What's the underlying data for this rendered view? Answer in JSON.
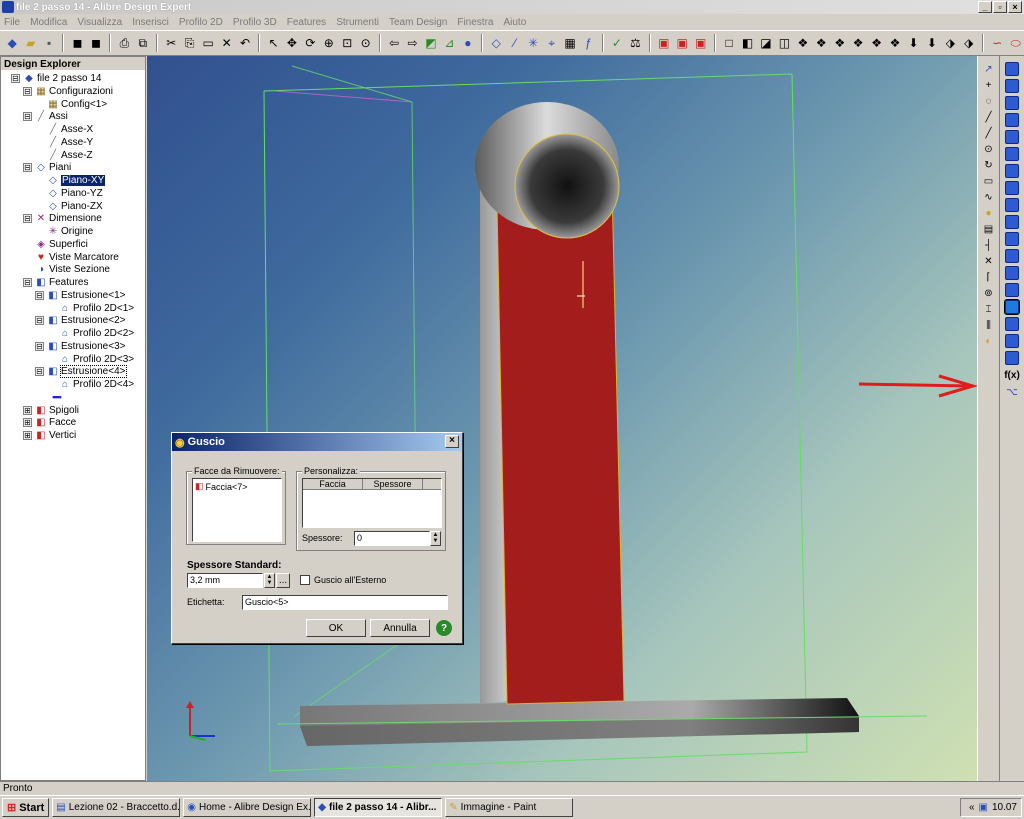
{
  "window": {
    "title": "file 2 passo 14 - Alibre Design Expert",
    "min": "_",
    "max": "▫",
    "close": "×"
  },
  "menu": [
    "File",
    "Modifica",
    "Visualizza",
    "Inserisci",
    "Profilo 2D",
    "Profilo 3D",
    "Features",
    "Strumenti",
    "Team Design",
    "Finestra",
    "Aiuto"
  ],
  "explorer": {
    "title": "Design Explorer",
    "nodes": [
      {
        "label": "file 2 passo 14",
        "level": 0,
        "exp": "⊟",
        "icon": "part-icon"
      },
      {
        "label": "Configurazioni",
        "level": 1,
        "exp": "⊟",
        "icon": "config-icon"
      },
      {
        "label": "Config<1>",
        "level": 2,
        "exp": "",
        "icon": "config-item-icon"
      },
      {
        "label": "Assi",
        "level": 1,
        "exp": "⊟",
        "icon": "axes-icon"
      },
      {
        "label": "Asse-X",
        "level": 2,
        "exp": "",
        "icon": "axis-icon"
      },
      {
        "label": "Asse-Y",
        "level": 2,
        "exp": "",
        "icon": "axis-icon"
      },
      {
        "label": "Asse-Z",
        "level": 2,
        "exp": "",
        "icon": "axis-icon"
      },
      {
        "label": "Piani",
        "level": 1,
        "exp": "⊟",
        "icon": "planes-icon"
      },
      {
        "label": "Piano-XY",
        "level": 2,
        "exp": "",
        "icon": "plane-icon",
        "selected": true
      },
      {
        "label": "Piano-YZ",
        "level": 2,
        "exp": "",
        "icon": "plane-icon"
      },
      {
        "label": "Piano-ZX",
        "level": 2,
        "exp": "",
        "icon": "plane-icon"
      },
      {
        "label": "Dimensione",
        "level": 1,
        "exp": "⊟",
        "icon": "dimension-icon"
      },
      {
        "label": "Origine",
        "level": 2,
        "exp": "",
        "icon": "origin-icon"
      },
      {
        "label": "Superfici",
        "level": 1,
        "exp": "",
        "icon": "surface-icon"
      },
      {
        "label": "Viste Marcatore",
        "level": 1,
        "exp": "",
        "icon": "marker-view-icon"
      },
      {
        "label": "Viste Sezione",
        "level": 1,
        "exp": "",
        "icon": "section-view-icon"
      },
      {
        "label": "Features",
        "level": 1,
        "exp": "⊟",
        "icon": "features-icon"
      },
      {
        "label": "Estrusione<1>",
        "level": 2,
        "exp": "⊟",
        "icon": "extrusion-icon"
      },
      {
        "label": "Profilo 2D<1>",
        "level": 3,
        "exp": "",
        "icon": "sketch-icon"
      },
      {
        "label": "Estrusione<2>",
        "level": 2,
        "exp": "⊟",
        "icon": "extrusion-icon"
      },
      {
        "label": "Profilo 2D<2>",
        "level": 3,
        "exp": "",
        "icon": "sketch-icon"
      },
      {
        "label": "Estrusione<3>",
        "level": 2,
        "exp": "⊟",
        "icon": "extrusion-icon"
      },
      {
        "label": "Profilo 2D<3>",
        "level": 3,
        "exp": "",
        "icon": "sketch-icon"
      },
      {
        "label": "Estrusione<4>",
        "level": 2,
        "exp": "⊟",
        "icon": "extrusion-icon",
        "boxed": true
      },
      {
        "label": "Profilo 2D<4>",
        "level": 3,
        "exp": "",
        "icon": "sketch-icon"
      },
      {
        "label": "",
        "level": 1,
        "exp": "",
        "icon": "rollback-bar-icon"
      },
      {
        "label": "Spigoli",
        "level": 1,
        "exp": "⊞",
        "icon": "edges-icon"
      },
      {
        "label": "Facce",
        "level": 1,
        "exp": "⊞",
        "icon": "faces-icon"
      },
      {
        "label": "Vertici",
        "level": 1,
        "exp": "⊞",
        "icon": "vertices-icon"
      }
    ]
  },
  "dialog": {
    "title": "Guscio",
    "close": "×",
    "faces_group": "Facce da Rimuovere:",
    "faces_item": "Faccia<7>",
    "custom_group": "Personalizza:",
    "col_face": "Faccia",
    "col_thickness": "Spessore",
    "thickness_label": "Spessore:",
    "thickness_value": "0",
    "standard_label": "Spessore Standard:",
    "standard_value": "3,2 mm",
    "browse": "...",
    "outside_label": "Guscio all'Esterno",
    "name_label": "Etichetta:",
    "name_value": "Guscio<5>",
    "ok": "OK",
    "cancel": "Annulla",
    "help": "?"
  },
  "status": {
    "text": "Pronto"
  },
  "taskbar": {
    "start": "Start",
    "tasks": [
      {
        "label": "Lezione 02 - Braccetto.d...",
        "icon": "word-icon",
        "active": false
      },
      {
        "label": "Home - Alibre Design Ex...",
        "icon": "alibre-home-icon",
        "active": false
      },
      {
        "label": "file 2 passo 14 - Alibr...",
        "icon": "alibre-icon",
        "active": true
      },
      {
        "label": "Immagine - Paint",
        "icon": "paint-icon",
        "active": false
      }
    ],
    "tray_expand": "«",
    "clock": "10.07"
  },
  "colors": {
    "accent_red": "#e01c1c",
    "face_red": "#a31d1d",
    "wire_green": "#66dd66",
    "title_blue": "#0a246a"
  }
}
